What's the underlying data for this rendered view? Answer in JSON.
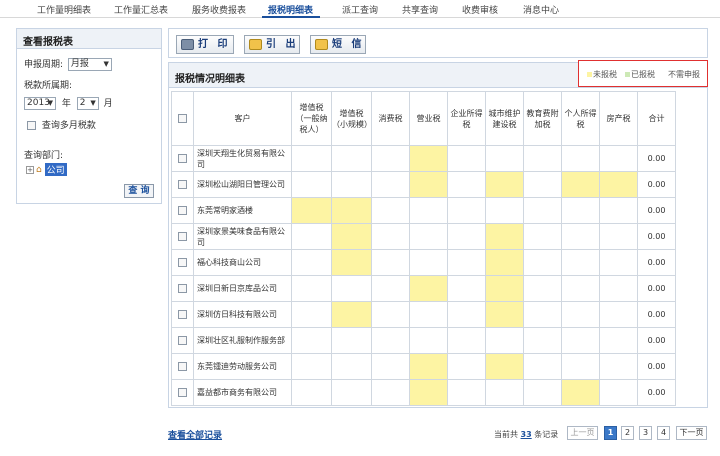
{
  "nav": {
    "tabs": [
      "工作量明细表",
      "工作量汇总表",
      "服务收费报表",
      "报税明细表",
      "派工查询",
      "共享查询",
      "收费审核",
      "消息中心"
    ],
    "active_index": 3
  },
  "left": {
    "title": "查看报税表",
    "period_label": "申报周期:",
    "period_value": "月报",
    "tax_period_label": "税款所属期:",
    "year_value": "2013",
    "year_unit": "年",
    "month_value": "2",
    "month_unit": "月",
    "multi_month_label": "查询多月税款",
    "dept_label": "查询部门:",
    "company_label": "公司",
    "query_label": "查 询"
  },
  "toolbar": {
    "print_label": "打 印",
    "export_label": "引 出",
    "sms_label": "短 信"
  },
  "main": {
    "title": "报税情况明细表",
    "legend": {
      "unfiled": "未报税",
      "filed": "已报税",
      "not_required": "不需申报",
      "colors": {
        "unfiled": "#fdf4a3",
        "filed": "#cde9b6"
      }
    }
  },
  "table": {
    "columns": [
      "客户",
      "增值税（一般纳税人）",
      "增值税（小规模）",
      "消费税",
      "营业税",
      "企业所得税",
      "城市维护建设税",
      "教育费附加税",
      "个人所得税",
      "房产税",
      "合计"
    ],
    "rows": [
      {
        "customer": "深圳天翔生化贸易有限公司",
        "yellow": [
          0,
          0,
          0,
          1,
          0,
          0,
          0,
          0,
          0
        ],
        "total": "0.00"
      },
      {
        "customer": "深圳松山湖阳日管理公司",
        "yellow": [
          0,
          0,
          0,
          1,
          0,
          1,
          0,
          1,
          1
        ],
        "total": "0.00"
      },
      {
        "customer": "东莞常明家酒楼",
        "yellow": [
          1,
          1,
          0,
          0,
          0,
          0,
          0,
          0,
          0
        ],
        "total": "0.00"
      },
      {
        "customer": "深圳家景美味食品有限公司",
        "yellow": [
          0,
          1,
          0,
          0,
          0,
          1,
          0,
          0,
          0
        ],
        "total": "0.00"
      },
      {
        "customer": "福心科技商山公司",
        "yellow": [
          0,
          1,
          0,
          0,
          0,
          1,
          0,
          0,
          0
        ],
        "total": "0.00"
      },
      {
        "customer": "深圳日新日京库品公司",
        "yellow": [
          0,
          0,
          0,
          1,
          0,
          1,
          0,
          0,
          0
        ],
        "total": "0.00"
      },
      {
        "customer": "深圳仿日科技有限公司",
        "yellow": [
          0,
          1,
          0,
          0,
          0,
          1,
          0,
          0,
          0
        ],
        "total": "0.00"
      },
      {
        "customer": "深圳壮区礼服制作服务部",
        "yellow": [
          0,
          0,
          0,
          0,
          0,
          0,
          0,
          0,
          0
        ],
        "total": "0.00"
      },
      {
        "customer": "东莞镭迪劳动服务公司",
        "yellow": [
          0,
          0,
          0,
          1,
          0,
          1,
          0,
          0,
          0
        ],
        "total": "0.00"
      },
      {
        "customer": "嘉益都市商务有限公司",
        "yellow": [
          0,
          0,
          0,
          1,
          0,
          0,
          0,
          1,
          0
        ],
        "total": "0.00"
      }
    ]
  },
  "footer": {
    "view_all": "查看全部记录",
    "count_prefix": "当前共",
    "count": "33",
    "count_suffix": "条记录",
    "prev": "上一页",
    "pages": [
      "1",
      "2",
      "3",
      "4"
    ],
    "current_page": "1",
    "next": "下一页"
  }
}
